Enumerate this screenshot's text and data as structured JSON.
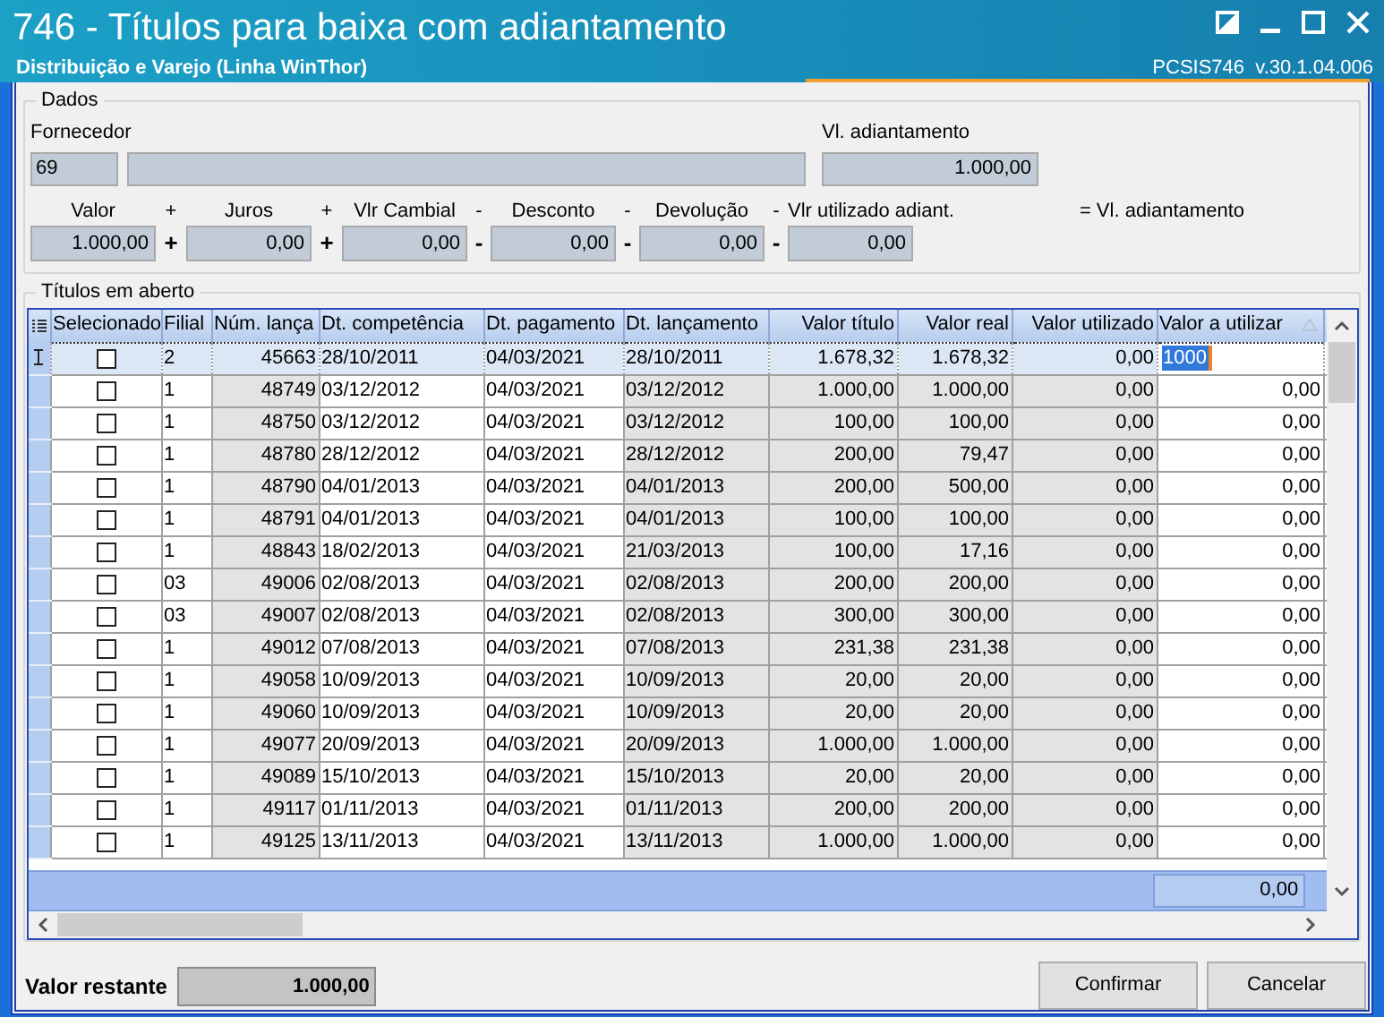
{
  "window": {
    "title": "746 - Títulos para baixa com adiantamento",
    "subtitle": "Distribuição e Varejo (Linha WinThor)",
    "version": "PCSIS746  v.30.1.04.006"
  },
  "dados": {
    "group_title": "Dados",
    "fornecedor_label": "Fornecedor",
    "fornecedor_code": "69",
    "adiantamento_label": "Vl. adiantamento",
    "adiantamento_value": "1.000,00",
    "terms": [
      {
        "label": "Valor",
        "value": "1.000,00"
      },
      {
        "label_operator": "+",
        "field_operator": "+",
        "label": "Juros",
        "value": "0,00"
      },
      {
        "label_operator": "+",
        "field_operator": "+",
        "label": "Vlr Cambial",
        "value": "0,00"
      },
      {
        "label_operator": "-",
        "field_operator": "-",
        "label": "Desconto",
        "value": "0,00"
      },
      {
        "label_operator": "-",
        "field_operator": "-",
        "label": "Devolução",
        "value": "0,00"
      },
      {
        "label_operator": "-",
        "field_operator": "-",
        "label": "Vlr utilizado adiant.",
        "value": "0,00"
      }
    ],
    "result_label": "= Vl. adiantamento"
  },
  "titulos": {
    "group_title": "Títulos em aberto",
    "checkbox_column": "Selecionado",
    "columns": [
      "Filial",
      "Núm. lança",
      "Dt. competência",
      "Dt. pagamento",
      "Dt. lançamento",
      "Valor título",
      "Valor real",
      "Valor utilizado",
      "Valor a utilizar"
    ],
    "rows": [
      {
        "selected": true,
        "checked": false,
        "cells": [
          "2",
          "45663",
          "28/10/2011",
          "04/03/2021",
          "28/10/2011",
          "1.678,32",
          "1.678,32",
          "0,00",
          "1000"
        ]
      },
      {
        "selected": false,
        "checked": false,
        "cells": [
          "1",
          "48749",
          "03/12/2012",
          "04/03/2021",
          "03/12/2012",
          "1.000,00",
          "1.000,00",
          "0,00",
          "0,00"
        ]
      },
      {
        "selected": false,
        "checked": false,
        "cells": [
          "1",
          "48750",
          "03/12/2012",
          "04/03/2021",
          "03/12/2012",
          "100,00",
          "100,00",
          "0,00",
          "0,00"
        ]
      },
      {
        "selected": false,
        "checked": false,
        "cells": [
          "1",
          "48780",
          "28/12/2012",
          "04/03/2021",
          "28/12/2012",
          "200,00",
          "79,47",
          "0,00",
          "0,00"
        ]
      },
      {
        "selected": false,
        "checked": false,
        "cells": [
          "1",
          "48790",
          "04/01/2013",
          "04/03/2021",
          "04/01/2013",
          "200,00",
          "500,00",
          "0,00",
          "0,00"
        ]
      },
      {
        "selected": false,
        "checked": false,
        "cells": [
          "1",
          "48791",
          "04/01/2013",
          "04/03/2021",
          "04/01/2013",
          "100,00",
          "100,00",
          "0,00",
          "0,00"
        ]
      },
      {
        "selected": false,
        "checked": false,
        "cells": [
          "1",
          "48843",
          "18/02/2013",
          "04/03/2021",
          "21/03/2013",
          "100,00",
          "17,16",
          "0,00",
          "0,00"
        ]
      },
      {
        "selected": false,
        "checked": false,
        "cells": [
          "03",
          "49006",
          "02/08/2013",
          "04/03/2021",
          "02/08/2013",
          "200,00",
          "200,00",
          "0,00",
          "0,00"
        ]
      },
      {
        "selected": false,
        "checked": false,
        "cells": [
          "03",
          "49007",
          "02/08/2013",
          "04/03/2021",
          "02/08/2013",
          "300,00",
          "300,00",
          "0,00",
          "0,00"
        ]
      },
      {
        "selected": false,
        "checked": false,
        "cells": [
          "1",
          "49012",
          "07/08/2013",
          "04/03/2021",
          "07/08/2013",
          "231,38",
          "231,38",
          "0,00",
          "0,00"
        ]
      },
      {
        "selected": false,
        "checked": false,
        "cells": [
          "1",
          "49058",
          "10/09/2013",
          "04/03/2021",
          "10/09/2013",
          "20,00",
          "20,00",
          "0,00",
          "0,00"
        ]
      },
      {
        "selected": false,
        "checked": false,
        "cells": [
          "1",
          "49060",
          "10/09/2013",
          "04/03/2021",
          "10/09/2013",
          "20,00",
          "20,00",
          "0,00",
          "0,00"
        ]
      },
      {
        "selected": false,
        "checked": false,
        "cells": [
          "1",
          "49077",
          "20/09/2013",
          "04/03/2021",
          "20/09/2013",
          "1.000,00",
          "1.000,00",
          "0,00",
          "0,00"
        ]
      },
      {
        "selected": false,
        "checked": false,
        "cells": [
          "1",
          "49089",
          "15/10/2013",
          "04/03/2021",
          "15/10/2013",
          "20,00",
          "20,00",
          "0,00",
          "0,00"
        ]
      },
      {
        "selected": false,
        "checked": false,
        "cells": [
          "1",
          "49117",
          "01/11/2013",
          "04/03/2021",
          "01/11/2013",
          "200,00",
          "200,00",
          "0,00",
          "0,00"
        ]
      },
      {
        "selected": false,
        "checked": false,
        "cells": [
          "1",
          "49125",
          "13/11/2013",
          "04/03/2021",
          "13/11/2013",
          "1.000,00",
          "1.000,00",
          "0,00",
          "0,00"
        ]
      }
    ],
    "total": "0,00"
  },
  "footer": {
    "restante_label": "Valor restante",
    "restante_value": "1.000,00",
    "buttons": [
      "Confirmar",
      "Cancelar"
    ]
  }
}
